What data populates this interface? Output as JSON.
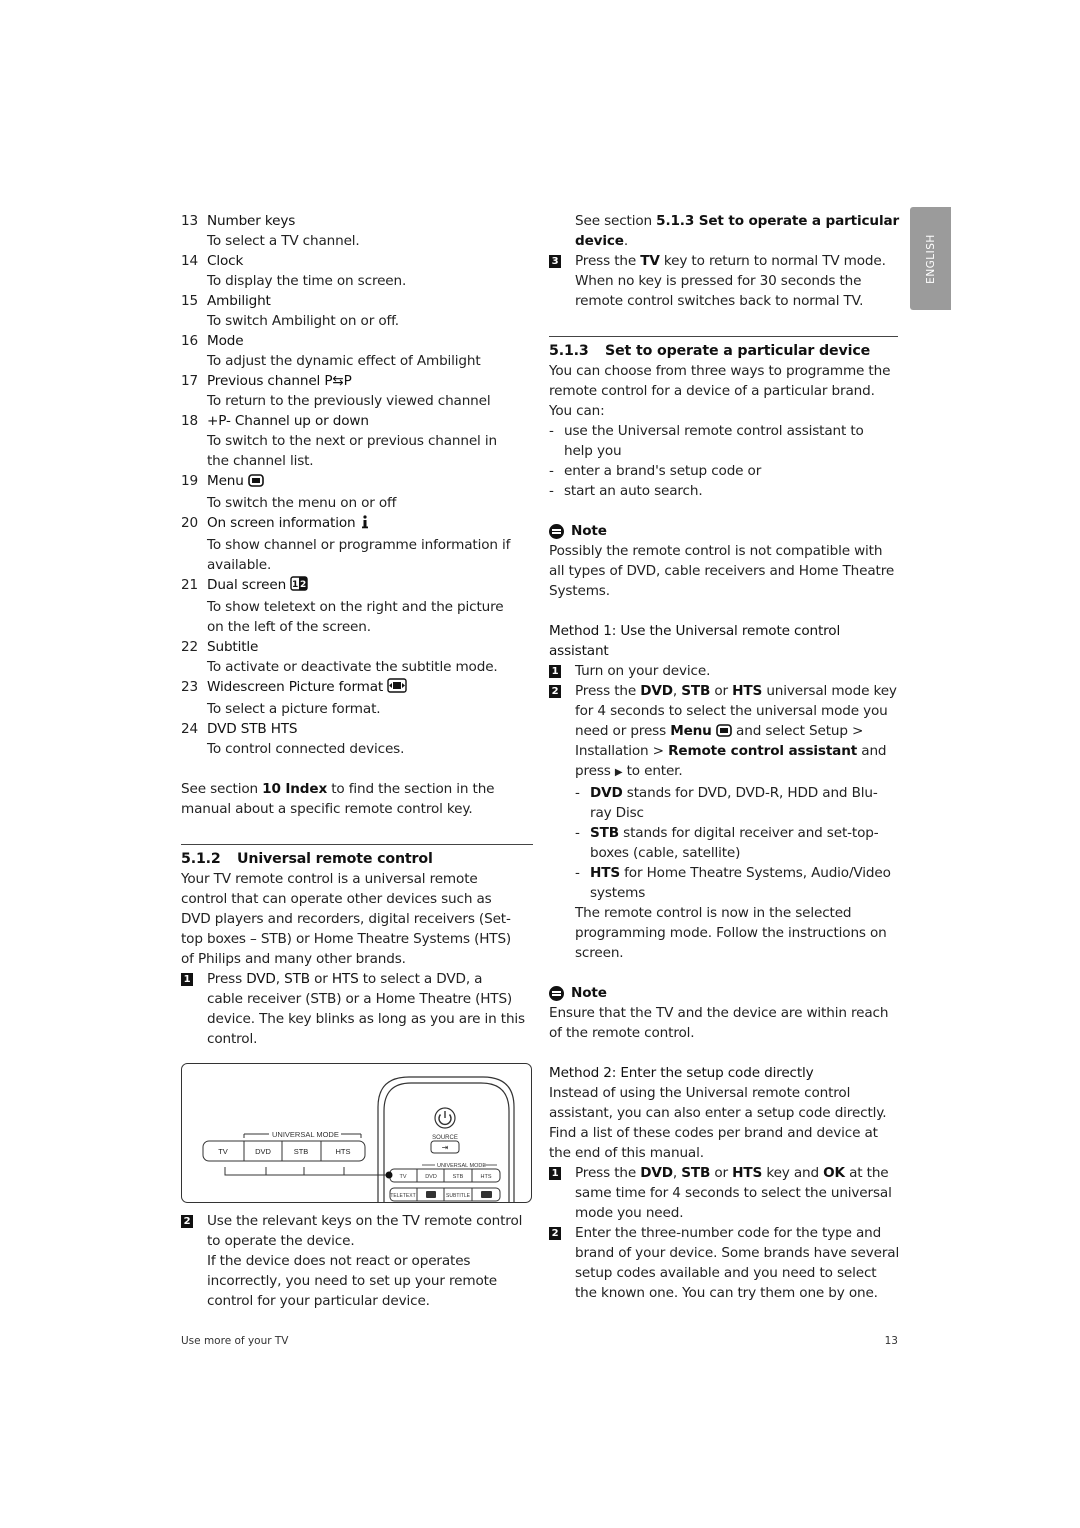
{
  "side_tab": {
    "label": "ENGLISH",
    "color": "#9b9b9b"
  },
  "key_list": [
    {
      "num": "13",
      "title": "Number keys",
      "desc": [
        "To select a TV channel."
      ]
    },
    {
      "num": "14",
      "title": "Clock",
      "desc": [
        "To display the time on screen."
      ]
    },
    {
      "num": "15",
      "title": "Ambilight",
      "desc": [
        "To switch Ambilight on or off."
      ]
    },
    {
      "num": "16",
      "title": "Mode",
      "desc": [
        "To adjust the dynamic effect of Ambilight"
      ]
    },
    {
      "num": "17",
      "title": "Previous channel P⇆P",
      "desc": [
        "To return to the previously viewed channel"
      ]
    },
    {
      "num": "18",
      "title": "+P-  Channel up or down",
      "desc": [
        "To switch to the next or previous channel in",
        "the channel list."
      ]
    },
    {
      "num": "19",
      "title": "Menu",
      "icon": "menu-icon",
      "desc": [
        "To switch the menu on or off"
      ]
    },
    {
      "num": "20",
      "title": "On screen information",
      "icon": "info-icon",
      "desc": [
        "To show channel or programme information if",
        "available."
      ]
    },
    {
      "num": "21",
      "title": "Dual screen",
      "icon": "dual-screen-icon",
      "desc": [
        "To show teletext on the right and the picture",
        "on the left of the screen."
      ]
    },
    {
      "num": "22",
      "title": "Subtitle",
      "desc": [
        "To activate or deactivate the subtitle mode."
      ]
    },
    {
      "num": "23",
      "title": "Widescreen Picture format",
      "icon": "widescreen-icon",
      "desc": [
        "To select a picture format."
      ]
    },
    {
      "num": "24",
      "title": "DVD  STB  HTS",
      "desc": [
        "To control connected devices."
      ]
    }
  ],
  "index_ref": {
    "prefix": "See section ",
    "bold": "10 Index",
    "suffix_line1": " to find the section in the",
    "line2": "manual about a specific remote control key."
  },
  "section_512": {
    "number": "5.1.2",
    "title": "Universal remote control",
    "intro": [
      "Your TV remote control is a universal remote",
      "control that can operate other devices such as",
      "DVD players and recorders, digital receivers (Set-",
      "top boxes – STB) or Home Theatre Systems (HTS)",
      "of Philips and many other brands."
    ],
    "step1": {
      "badge": "1",
      "l1_a": "Press ",
      "l1_b1": "DVD",
      "l1_c": ", ",
      "l1_b2": "STB",
      "l1_d": " or ",
      "l1_b3": "HTS",
      "l1_e": " to select a DVD, a",
      "lines": [
        "cable receiver (STB) or a Home Theatre (HTS)",
        "device. The key blinks as long as you are in this",
        "control."
      ]
    },
    "illustration": {
      "universal_mode_label": "UNIVERSAL MODE",
      "buttons": [
        "TV",
        "DVD",
        "STB",
        "HTS"
      ],
      "source_label": "SOURCE",
      "small_buttons": [
        "TV",
        "DVD",
        "STB",
        "HTS"
      ],
      "bottom_buttons": [
        "TELETEXT",
        "SUBTITLE"
      ]
    },
    "step2": {
      "badge": "2",
      "lines": [
        "Use the relevant keys on the TV remote control",
        "to operate the device.",
        "If the device does not react or operates",
        "incorrectly, you need to set up your remote",
        "control for your particular device."
      ]
    },
    "see_section": {
      "prefix": "See section ",
      "bold1": "5.1.3 Set to operate a particular",
      "bold2": "device",
      "suffix": "."
    },
    "step3": {
      "badge": "3",
      "l1_a": "Press the ",
      "l1_b": "TV",
      "l1_c": " key to return to normal TV mode.",
      "lines": [
        "When no key is pressed for 30 seconds the",
        "remote control switches back to normal TV."
      ]
    }
  },
  "section_513": {
    "number": "5.1.3",
    "title": "Set to operate a particular device",
    "intro": [
      "You can choose from three ways to programme the",
      "remote control for a device of a particular brand.",
      "You can:"
    ],
    "options": [
      [
        "use the Universal remote control assistant to",
        "help you"
      ],
      [
        "enter a brand's setup code or"
      ],
      [
        "start an auto search."
      ]
    ],
    "note1": {
      "title": "Note",
      "lines": [
        "Possibly the remote control is not compatible with",
        "all types of DVD, cable receivers and Home Theatre",
        "Systems."
      ]
    },
    "method1": {
      "heading": [
        "Method 1: Use the Universal remote control",
        "assistant"
      ],
      "step1": {
        "badge": "1",
        "text": "Turn on your device."
      },
      "step2": {
        "badge": "2",
        "l1_a": "Press the ",
        "l1_b1": "DVD",
        "l1_c": ", ",
        "l1_b2": "STB",
        "l1_d": " or ",
        "l1_b3": "HTS",
        "l1_e": " universal mode key",
        "l2": "for 4 seconds to select the universal mode you",
        "l3_a": "need or press ",
        "l3_b": "Menu",
        "l3_c": " and select Setup >",
        "l4_a": "Installation > ",
        "l4_b": "Remote control assistant",
        "l4_c": " and",
        "l5_a": "press ",
        "l5_arrow": "▶",
        "l5_b": " to enter.",
        "sub": [
          {
            "bold": "DVD",
            "text": " stands for DVD, DVD-R, HDD and Blu-",
            "cont": "ray Disc"
          },
          {
            "bold": "STB",
            "text": " stands for digital receiver and set-top-",
            "cont": "boxes (cable, satellite)"
          },
          {
            "bold": "HTS",
            "text": " for Home Theatre Systems, Audio/Video",
            "cont": "systems"
          }
        ],
        "after": [
          "The remote control is now in the selected",
          "programming mode. Follow the instructions on",
          "screen."
        ]
      }
    },
    "note2": {
      "title": "Note",
      "lines": [
        "Ensure that the TV and the device are within reach",
        "of the remote control."
      ]
    },
    "method2": {
      "heading": "Method 2: Enter the setup code directly",
      "intro": [
        "Instead of using the Universal remote control",
        "assistant, you can also enter a setup code directly.",
        "Find a list of these codes per brand and device at",
        "the end of this manual."
      ],
      "step1": {
        "badge": "1",
        "l1_a": "Press the ",
        "l1_b1": "DVD",
        "l1_c": ", ",
        "l1_b2": "STB",
        "l1_d": " or ",
        "l1_b3": "HTS",
        "l1_e": " key and ",
        "l1_b4": "OK",
        "l1_f": " at the",
        "lines": [
          "same time for 4 seconds to select the universal",
          "mode you need."
        ]
      },
      "step2": {
        "badge": "2",
        "lines": [
          "Enter the three-number code for the type and",
          "brand of your device. Some brands have several",
          "setup codes available and you need to select",
          "the known one. You can try them one by one."
        ]
      }
    }
  },
  "footer": {
    "left": "Use more of your TV",
    "page_number": "13"
  }
}
